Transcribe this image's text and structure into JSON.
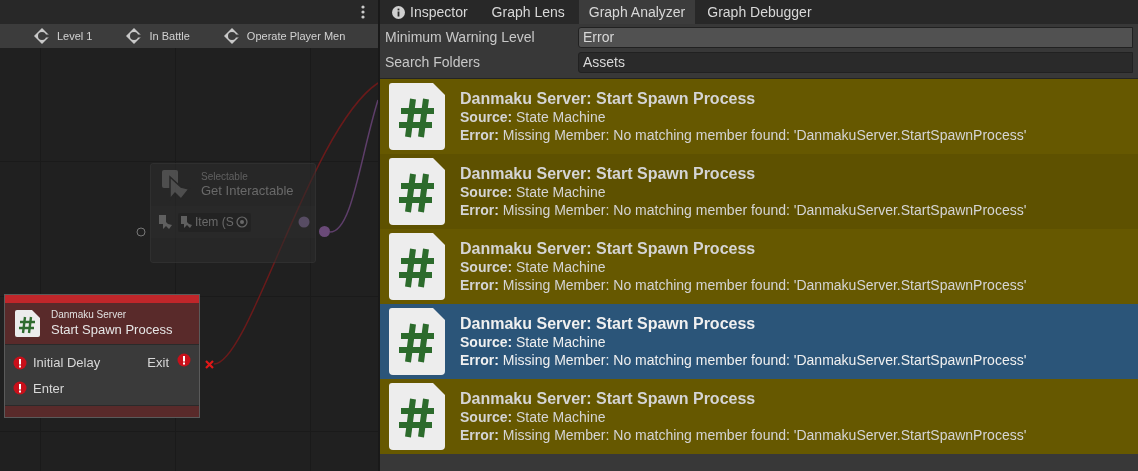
{
  "graph": {
    "breadcrumbs": [
      "Level 1",
      "In Battle",
      "Operate Player Men"
    ],
    "nodes": [
      {
        "kind": "unit",
        "dimmed": true,
        "subtitle": "Selectable",
        "title": "Get Interactable",
        "port": "Item (S"
      },
      {
        "kind": "error",
        "dimmed": false,
        "subtitle": "Danmaku Server",
        "title": "Start Spawn Process",
        "inputs": [
          "Initial Delay",
          "Enter"
        ],
        "output": "Exit"
      }
    ]
  },
  "tabs": [
    {
      "label": "Inspector",
      "selected": false
    },
    {
      "label": "Graph Lens",
      "selected": false
    },
    {
      "label": "Graph Analyzer",
      "selected": true
    },
    {
      "label": "Graph Debugger",
      "selected": false
    }
  ],
  "fields": [
    {
      "label": "Minimum Warning Level",
      "value": "Error"
    },
    {
      "label": "Search Folders",
      "value": "Assets"
    }
  ],
  "results": [
    {
      "title": "Danmaku Server: Start Spawn Process",
      "source_label": "Source:",
      "source": "State Machine",
      "error_label": "Error:",
      "error": "Missing Member: No matching member found: 'DanmakuServer.StartSpawnProcess'",
      "selected": false
    },
    {
      "title": "Danmaku Server: Start Spawn Process",
      "source_label": "Source:",
      "source": "State Machine",
      "error_label": "Error:",
      "error": "Missing Member: No matching member found: 'DanmakuServer.StartSpawnProcess'",
      "selected": false
    },
    {
      "title": "Danmaku Server: Start Spawn Process",
      "source_label": "Source:",
      "source": "State Machine",
      "error_label": "Error:",
      "error": "Missing Member: No matching member found: 'DanmakuServer.StartSpawnProcess'",
      "selected": false
    },
    {
      "title": "Danmaku Server: Start Spawn Process",
      "source_label": "Source:",
      "source": "State Machine",
      "error_label": "Error:",
      "error": "Missing Member: No matching member found: 'DanmakuServer.StartSpawnProcess'",
      "selected": true
    },
    {
      "title": "Danmaku Server: Start Spawn Process",
      "source_label": "Source:",
      "source": "State Machine",
      "error_label": "Error:",
      "error": "Missing Member: No matching member found: 'DanmakuServer.StartSpawnProcess'",
      "selected": false
    }
  ]
}
